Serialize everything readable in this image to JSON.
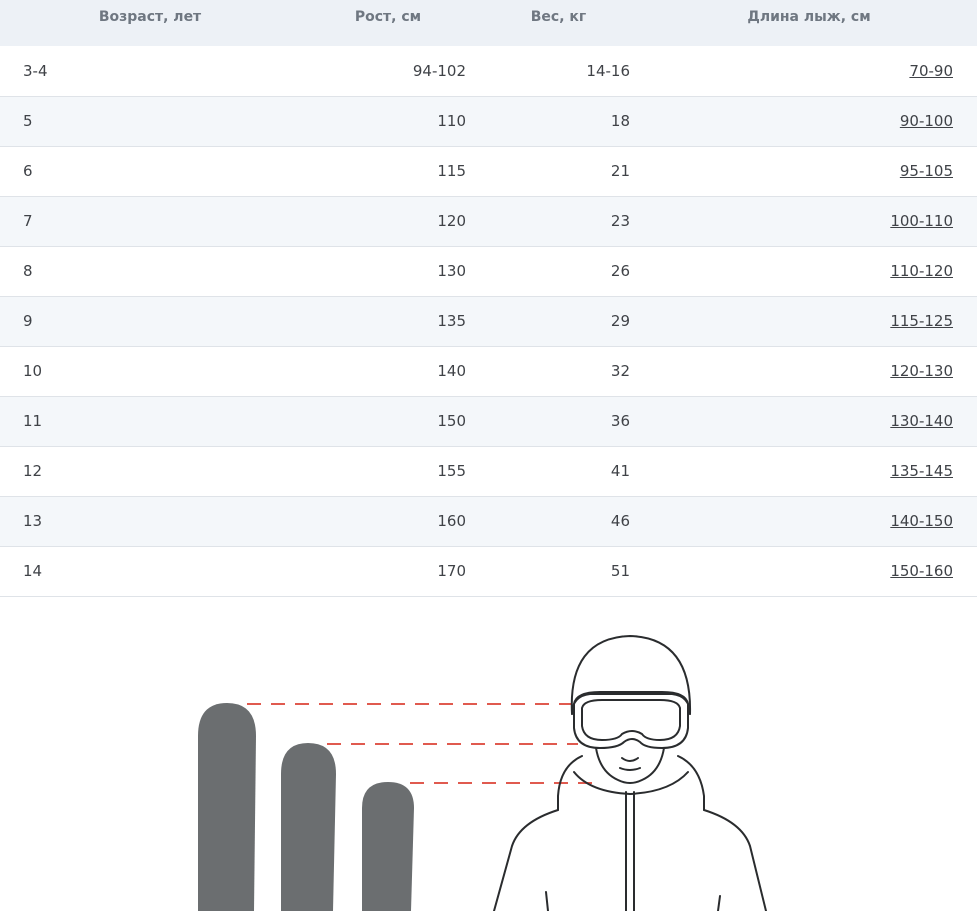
{
  "table": {
    "headers": {
      "age": "Возраст, лет",
      "height": "Рост, см",
      "weight": "Вес, кг",
      "length": "Длина лыж, см"
    },
    "rows": [
      {
        "age": "3-4",
        "height": "94-102",
        "weight": "14-16",
        "length": "70-90"
      },
      {
        "age": "5",
        "height": "110",
        "weight": "18",
        "length": "90-100"
      },
      {
        "age": "6",
        "height": "115",
        "weight": "21",
        "length": "95-105"
      },
      {
        "age": "7",
        "height": "120",
        "weight": "23",
        "length": "100-110"
      },
      {
        "age": "8",
        "height": "130",
        "weight": "26",
        "length": "110-120"
      },
      {
        "age": "9",
        "height": "135",
        "weight": "29",
        "length": "115-125"
      },
      {
        "age": "10",
        "height": "140",
        "weight": "32",
        "length": "120-130"
      },
      {
        "age": "11",
        "height": "150",
        "weight": "36",
        "length": "130-140"
      },
      {
        "age": "12",
        "height": "155",
        "weight": "41",
        "length": "135-145"
      },
      {
        "age": "13",
        "height": "160",
        "weight": "46",
        "length": "140-150"
      },
      {
        "age": "14",
        "height": "170",
        "weight": "51",
        "length": "150-160"
      }
    ]
  },
  "colors": {
    "header_bg": "#edf1f6",
    "header_text": "#6f7781",
    "stripe_bg": "#f4f7fa",
    "ski_fill": "#6b6e70",
    "guide_dash": "#e05a4f"
  },
  "icons": [
    "ski-icon",
    "skier-helmet-goggles-icon"
  ]
}
